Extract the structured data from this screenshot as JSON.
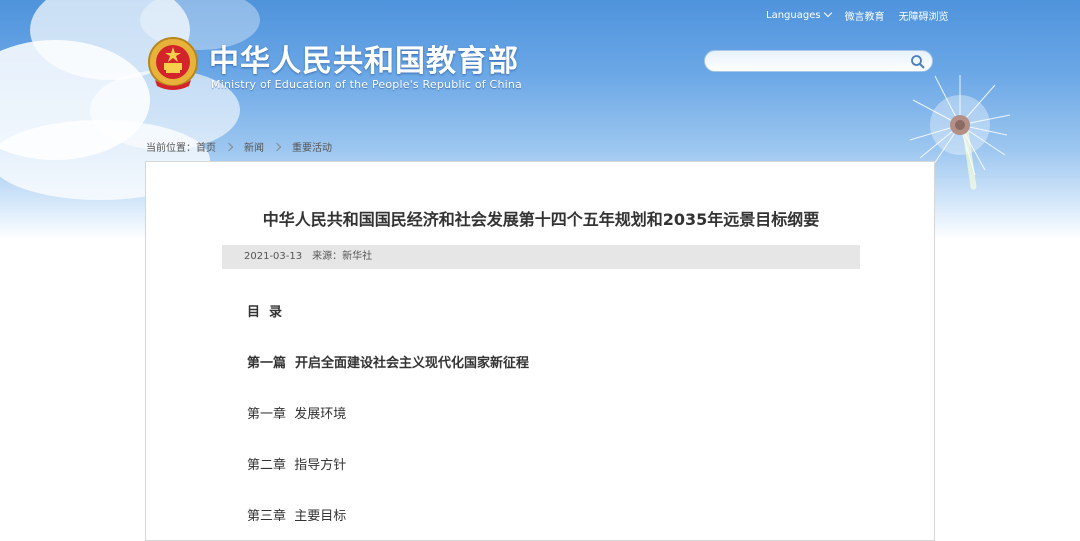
{
  "header": {
    "site_title": "中华人民共和国教育部",
    "site_subtitle": "Ministry of Education of the People's Republic of China",
    "util_links": {
      "languages": "Languages",
      "wechat": "微言教育",
      "accessibility": "无障碍浏览"
    },
    "search": {
      "placeholder": "",
      "value": ""
    }
  },
  "breadcrumb": {
    "prefix": "当前位置：",
    "home": "首页",
    "news": "新闻",
    "current": "重要活动"
  },
  "article": {
    "title": "中华人民共和国国民经济和社会发展第十四个五年规划和2035年远景目标纲要",
    "date": "2021-03-13",
    "source": "来源：新华社",
    "toc_heading": "目  录",
    "part1": "第一篇  开启全面建设社会主义现代化国家新征程",
    "chapter1": "第一章  发展环境",
    "chapter2": "第二章  指导方针",
    "chapter3": "第三章  主要目标"
  },
  "colors": {
    "sky_top": "#4f93dc",
    "title_text": "#333333",
    "meta_bg": "#e6e6e6"
  }
}
